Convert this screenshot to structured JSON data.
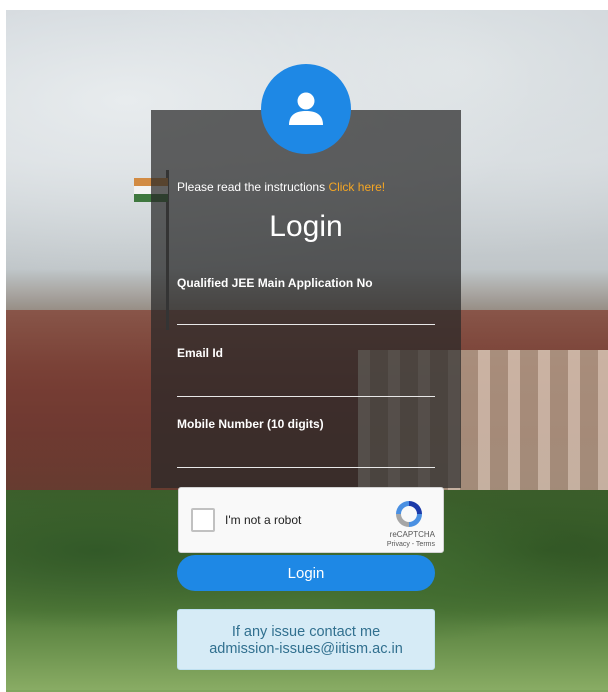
{
  "instructions": {
    "text": "Please read the instructions",
    "link": "Click here!"
  },
  "login": {
    "title": "Login",
    "fields": [
      {
        "label": "Qualified JEE Main Application No",
        "value": ""
      },
      {
        "label": "Email Id",
        "value": ""
      },
      {
        "label": "Mobile Number (10 digits)",
        "value": ""
      }
    ],
    "button_label": "Login"
  },
  "recaptcha": {
    "label": "I'm not a robot",
    "brand": "reCAPTCHA",
    "terms": "Privacy - Terms",
    "checked": false
  },
  "contact": {
    "line1": "If any issue contact me",
    "line2": "admission-issues@iitism.ac.in"
  },
  "icons": {
    "avatar": "user-icon",
    "recaptcha": "recaptcha-logo-icon"
  },
  "colors": {
    "accent": "#1e88e5",
    "link": "#f5a623",
    "contact_bg": "#d6ebf6",
    "contact_text": "#31708f"
  }
}
